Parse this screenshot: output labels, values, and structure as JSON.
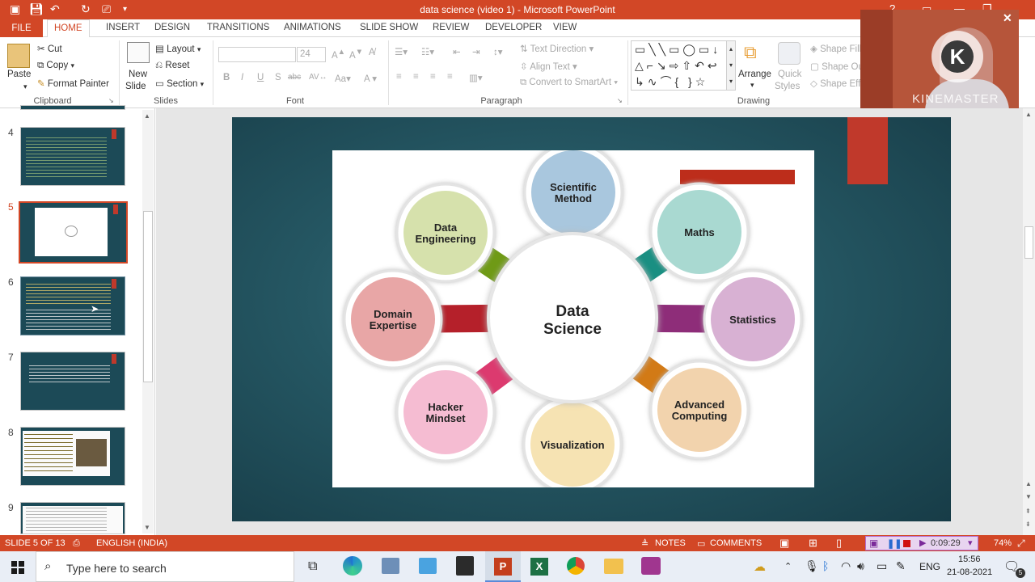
{
  "window": {
    "title": "data science (video 1) -  Microsoft PowerPoint"
  },
  "tabs": [
    "FILE",
    "HOME",
    "INSERT",
    "DESIGN",
    "TRANSITIONS",
    "ANIMATIONS",
    "SLIDE SHOW",
    "REVIEW",
    "DEVELOPER",
    "VIEW"
  ],
  "ribbon": {
    "clipboard": {
      "paste": "Paste",
      "cut": "Cut",
      "copy": "Copy",
      "format_painter": "Format Painter",
      "label": "Clipboard"
    },
    "slides": {
      "new_slide_1": "New",
      "new_slide_2": "Slide",
      "layout": "Layout",
      "reset": "Reset",
      "section": "Section",
      "label": "Slides"
    },
    "font": {
      "size": "24",
      "label": "Font"
    },
    "paragraph": {
      "text_direction": "Text Direction",
      "align_text": "Align Text",
      "convert": "Convert to SmartArt",
      "label": "Paragraph"
    },
    "drawing": {
      "arrange": "Arrange",
      "quick_1": "Quick",
      "quick_2": "Styles",
      "shape_fill": "Shape Fill",
      "shape_outline": "Shape Ou",
      "shape_effects": "Shape Eff",
      "label": "Drawing"
    }
  },
  "thumbnails": [
    {
      "num": "4"
    },
    {
      "num": "5"
    },
    {
      "num": "6"
    },
    {
      "num": "7"
    },
    {
      "num": "8"
    },
    {
      "num": "9"
    }
  ],
  "diagram": {
    "center_1": "Data",
    "center_2": "Science",
    "nodes": [
      {
        "l1": "Scientific",
        "l2": "Method",
        "fill": "#a9c7de",
        "arm": "#2e7fb0"
      },
      {
        "l1": "Maths",
        "l2": "",
        "fill": "#a9d9d1",
        "arm": "#1a8f82"
      },
      {
        "l1": "Statistics",
        "l2": "",
        "fill": "#d8b1d3",
        "arm": "#8e2d79"
      },
      {
        "l1": "Advanced",
        "l2": "Computing",
        "fill": "#f2d3ad",
        "arm": "#d27a16"
      },
      {
        "l1": "Visualization",
        "l2": "",
        "fill": "#f6e3b3",
        "arm": "#d9a21b"
      },
      {
        "l1": "Hacker",
        "l2": "Mindset",
        "fill": "#f5bcd2",
        "arm": "#dc3a6f"
      },
      {
        "l1": "Domain",
        "l2": "Expertise",
        "fill": "#e8a6a6",
        "arm": "#b5202a"
      },
      {
        "l1": "Data",
        "l2": "Engineering",
        "fill": "#d6e1ac",
        "arm": "#6f9a16"
      }
    ]
  },
  "status": {
    "slide": "SLIDE 5 OF 13",
    "language": "ENGLISH (INDIA)",
    "notes": "NOTES",
    "comments": "COMMENTS",
    "time": "0:09:29",
    "zoom": "74%"
  },
  "taskbar": {
    "search": "Type here to search",
    "lang": "ENG",
    "clock": "15:56",
    "date": "21-08-2021",
    "notif": "5"
  },
  "webcam": {
    "watermark": "KINEMASTER"
  },
  "colors": {
    "accent": "#d24726"
  }
}
